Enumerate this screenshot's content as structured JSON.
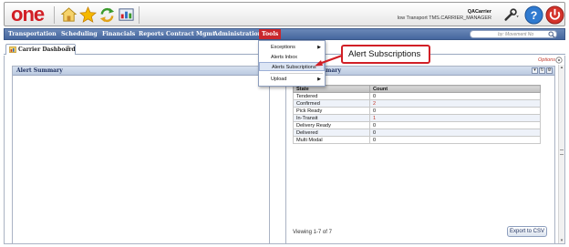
{
  "header": {
    "logo_text": "one",
    "user_name": "QACarrier",
    "user_role": "low Transport TMS.CARRIER_MANAGER",
    "icons": [
      "home-icon",
      "star-icon",
      "refresh-icon",
      "dashboard-icon",
      "wrench-icon",
      "help-icon",
      "power-icon"
    ]
  },
  "nav": {
    "items": [
      "Transportation",
      "Scheduling",
      "Financials",
      "Reports",
      "Contract Mgmt",
      "Administration",
      "Tools"
    ],
    "active": "Tools",
    "search_placeholder": "by: Movement No"
  },
  "tab": {
    "label": "Carrier Dashboard"
  },
  "options_label": "Options",
  "left_portlet": {
    "title": "Alert Summary"
  },
  "right_portlet": {
    "title": "Summary",
    "columns": [
      "State",
      "Count"
    ],
    "rows": [
      {
        "state": "Tendered",
        "count": "0"
      },
      {
        "state": "Confirmed",
        "count": "2"
      },
      {
        "state": "Pick Ready",
        "count": "0"
      },
      {
        "state": "In-Transit",
        "count": "1"
      },
      {
        "state": "Delivery Ready",
        "count": "0"
      },
      {
        "state": "Delivered",
        "count": "0"
      },
      {
        "state": "Multi Modal",
        "count": "0"
      }
    ],
    "footer": "Viewing 1-7 of 7",
    "export_label": "Export to CSV"
  },
  "menu": {
    "items": [
      {
        "label": "Exceptions",
        "submenu": true
      },
      {
        "label": "Alerts Inbox",
        "submenu": false
      },
      {
        "label": "Alerts Subscriptions",
        "submenu": false
      },
      {
        "label": "Upload",
        "submenu": true
      }
    ]
  },
  "callout": {
    "text": "Alert Subscriptions"
  },
  "colors": {
    "brand_red": "#d11f26",
    "nav_blue": "#45669e",
    "link_red": "#c0392b"
  }
}
